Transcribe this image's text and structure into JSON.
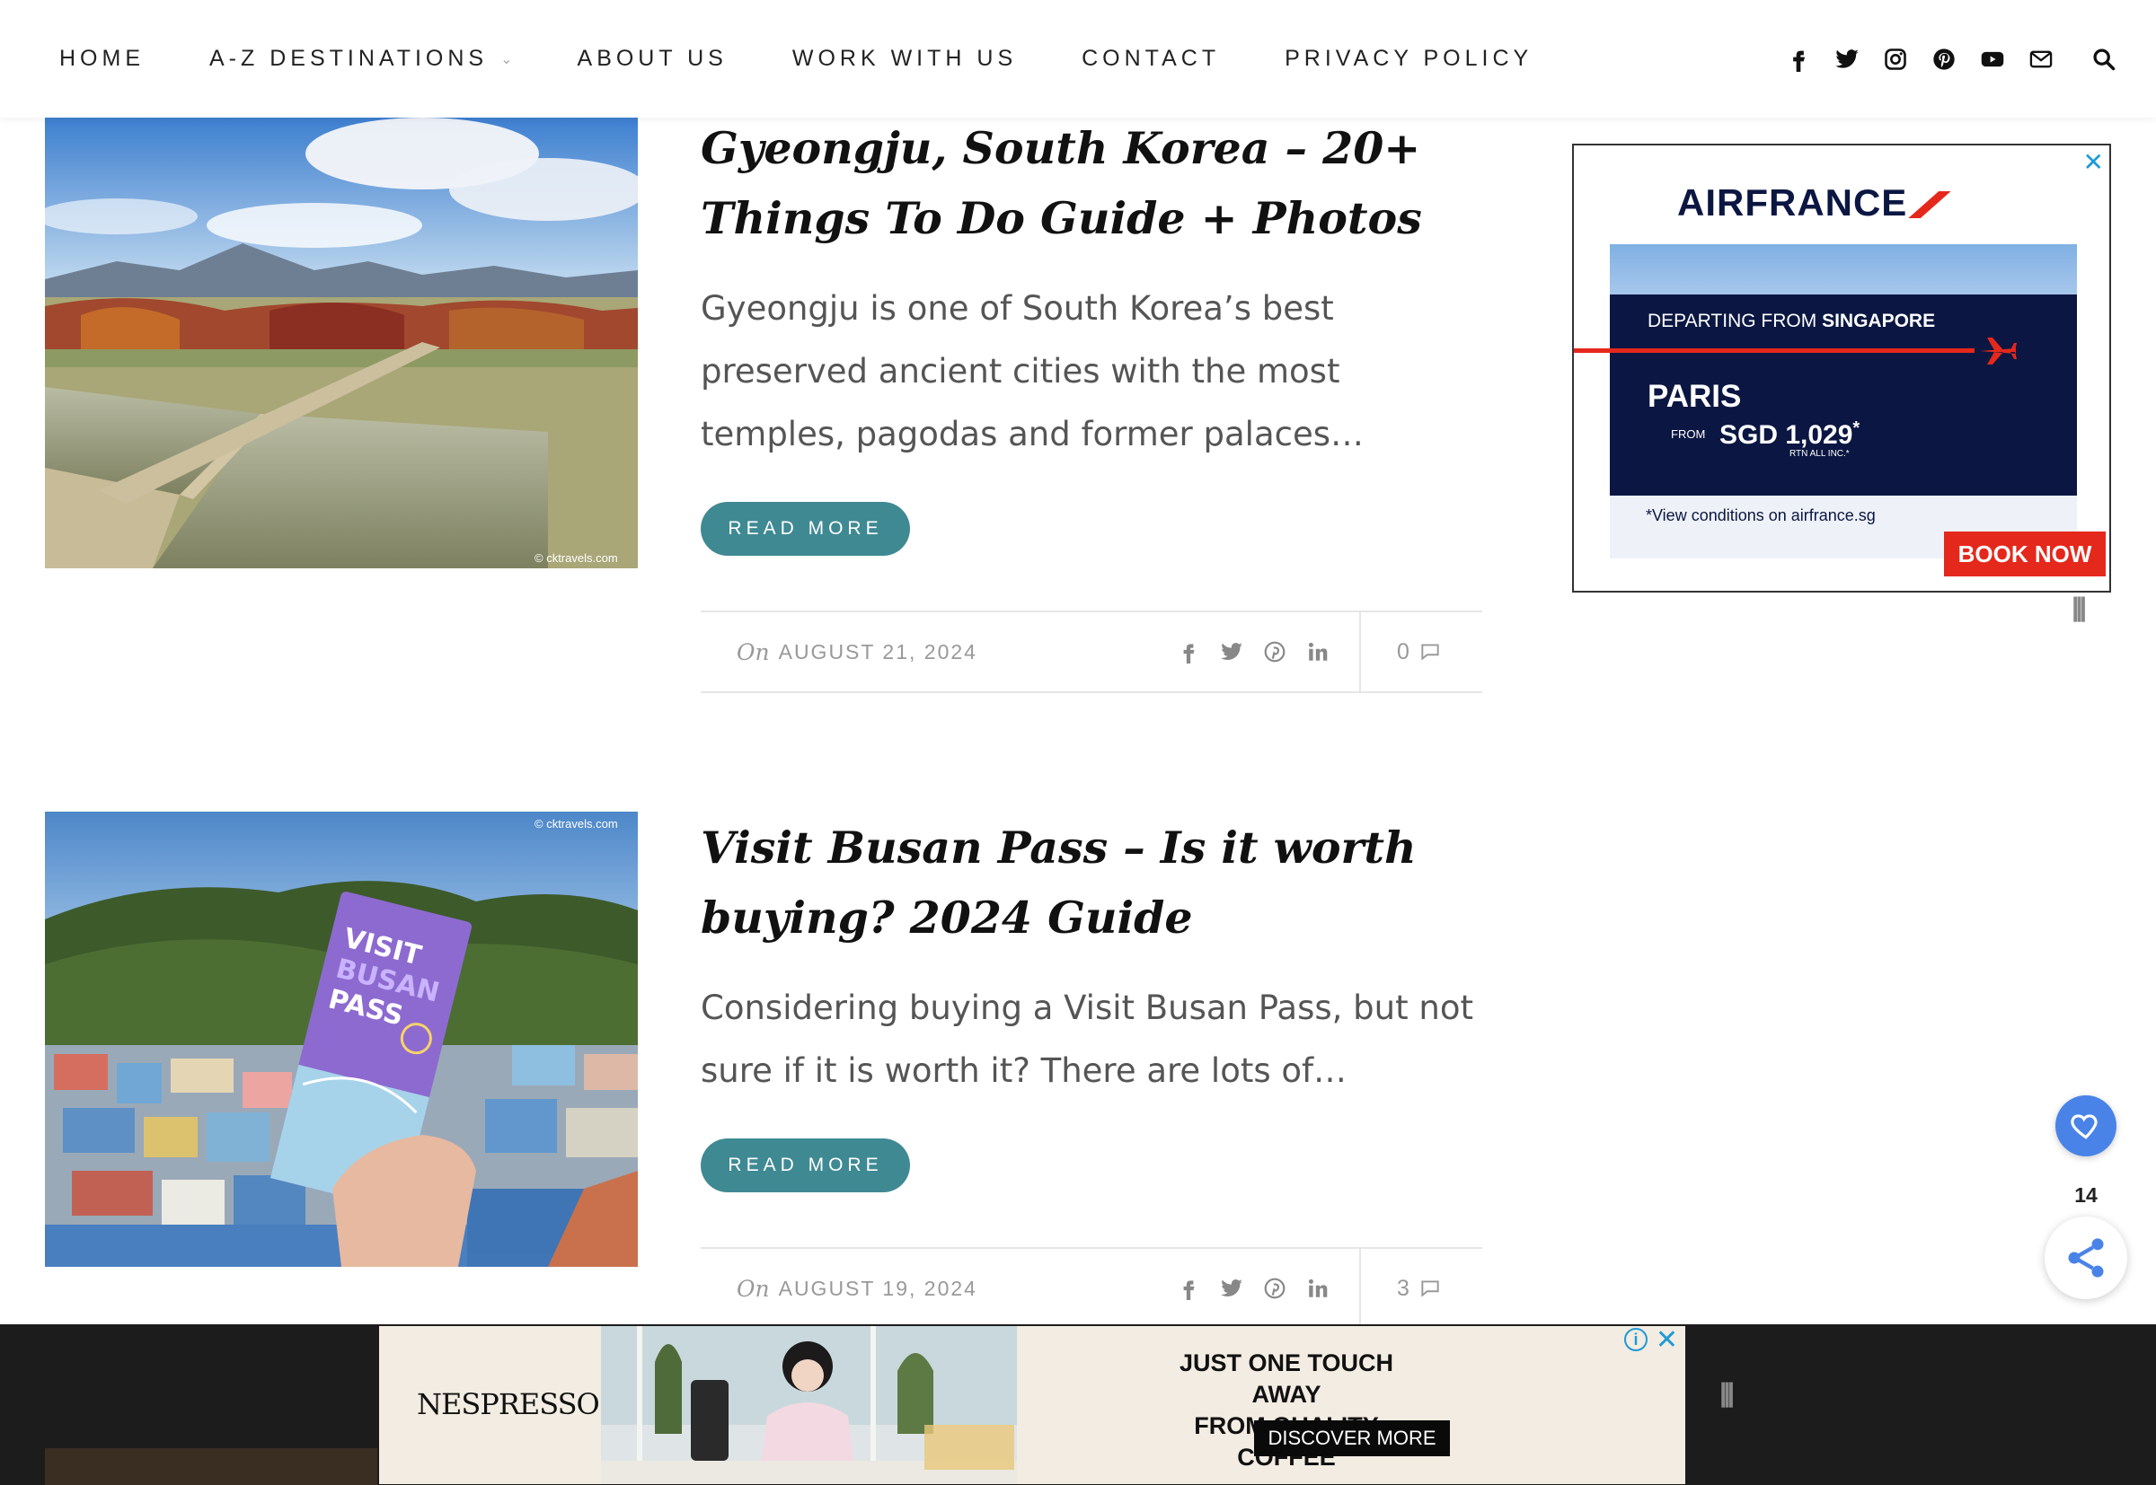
{
  "nav": {
    "items": [
      {
        "label": "HOME"
      },
      {
        "label": "A-Z DESTINATIONS",
        "has_dropdown": true
      },
      {
        "label": "ABOUT US"
      },
      {
        "label": "WORK WITH US"
      },
      {
        "label": "CONTACT"
      },
      {
        "label": "PRIVACY POLICY"
      }
    ],
    "social_icons": [
      "facebook-icon",
      "twitter-icon",
      "instagram-icon",
      "pinterest-icon",
      "youtube-icon",
      "email-icon"
    ],
    "search_icon": "search-icon"
  },
  "posts": [
    {
      "title": "Gyeongju, South Korea – 20+ Things To Do Guide + Photos",
      "excerpt": "Gyeongju is one of South Korea’s best preserved ancient cities with the most temples, pagodas and former palaces…",
      "read_more": "READ MORE",
      "date_prefix": "On",
      "date": "AUGUST 21, 2024",
      "comments": "0",
      "image_credit": "© cktravels.com"
    },
    {
      "title": "Visit Busan Pass – Is it worth buying? 2024 Guide",
      "excerpt": "Considering buying a Visit Busan Pass, but not sure if it is worth it? There are lots of…",
      "read_more": "READ MORE",
      "date_prefix": "On",
      "date": "AUGUST 19, 2024",
      "comments": "3",
      "image_credit": "© cktravels.com",
      "pass_text": "VISIT BUSAN PASS"
    }
  ],
  "side_ad": {
    "brand": "AIRFRANCE",
    "departing": "DEPARTING FROM",
    "departing_city": "SINGAPORE",
    "destination": "PARIS",
    "from_label": "FROM",
    "price": "SGD 1,029",
    "price_mark": "*",
    "price_note": "RTN ALL INC.*",
    "conditions": "*View conditions on airfrance.sg",
    "cta": "BOOK NOW",
    "close": "✕"
  },
  "floating": {
    "share_count": "14"
  },
  "bottom_ad": {
    "brand": "NESPRESSO",
    "headline_1": "JUST ONE TOUCH AWAY",
    "headline_2": "FROM QUALITY COFFEE",
    "cta": "DISCOVER MORE",
    "info": "i",
    "close": "✕"
  },
  "colors": {
    "accent": "#3f8993",
    "airfrance_navy": "#0b1742",
    "airfrance_red": "#e5281c",
    "float_blue": "#4a83e8"
  }
}
